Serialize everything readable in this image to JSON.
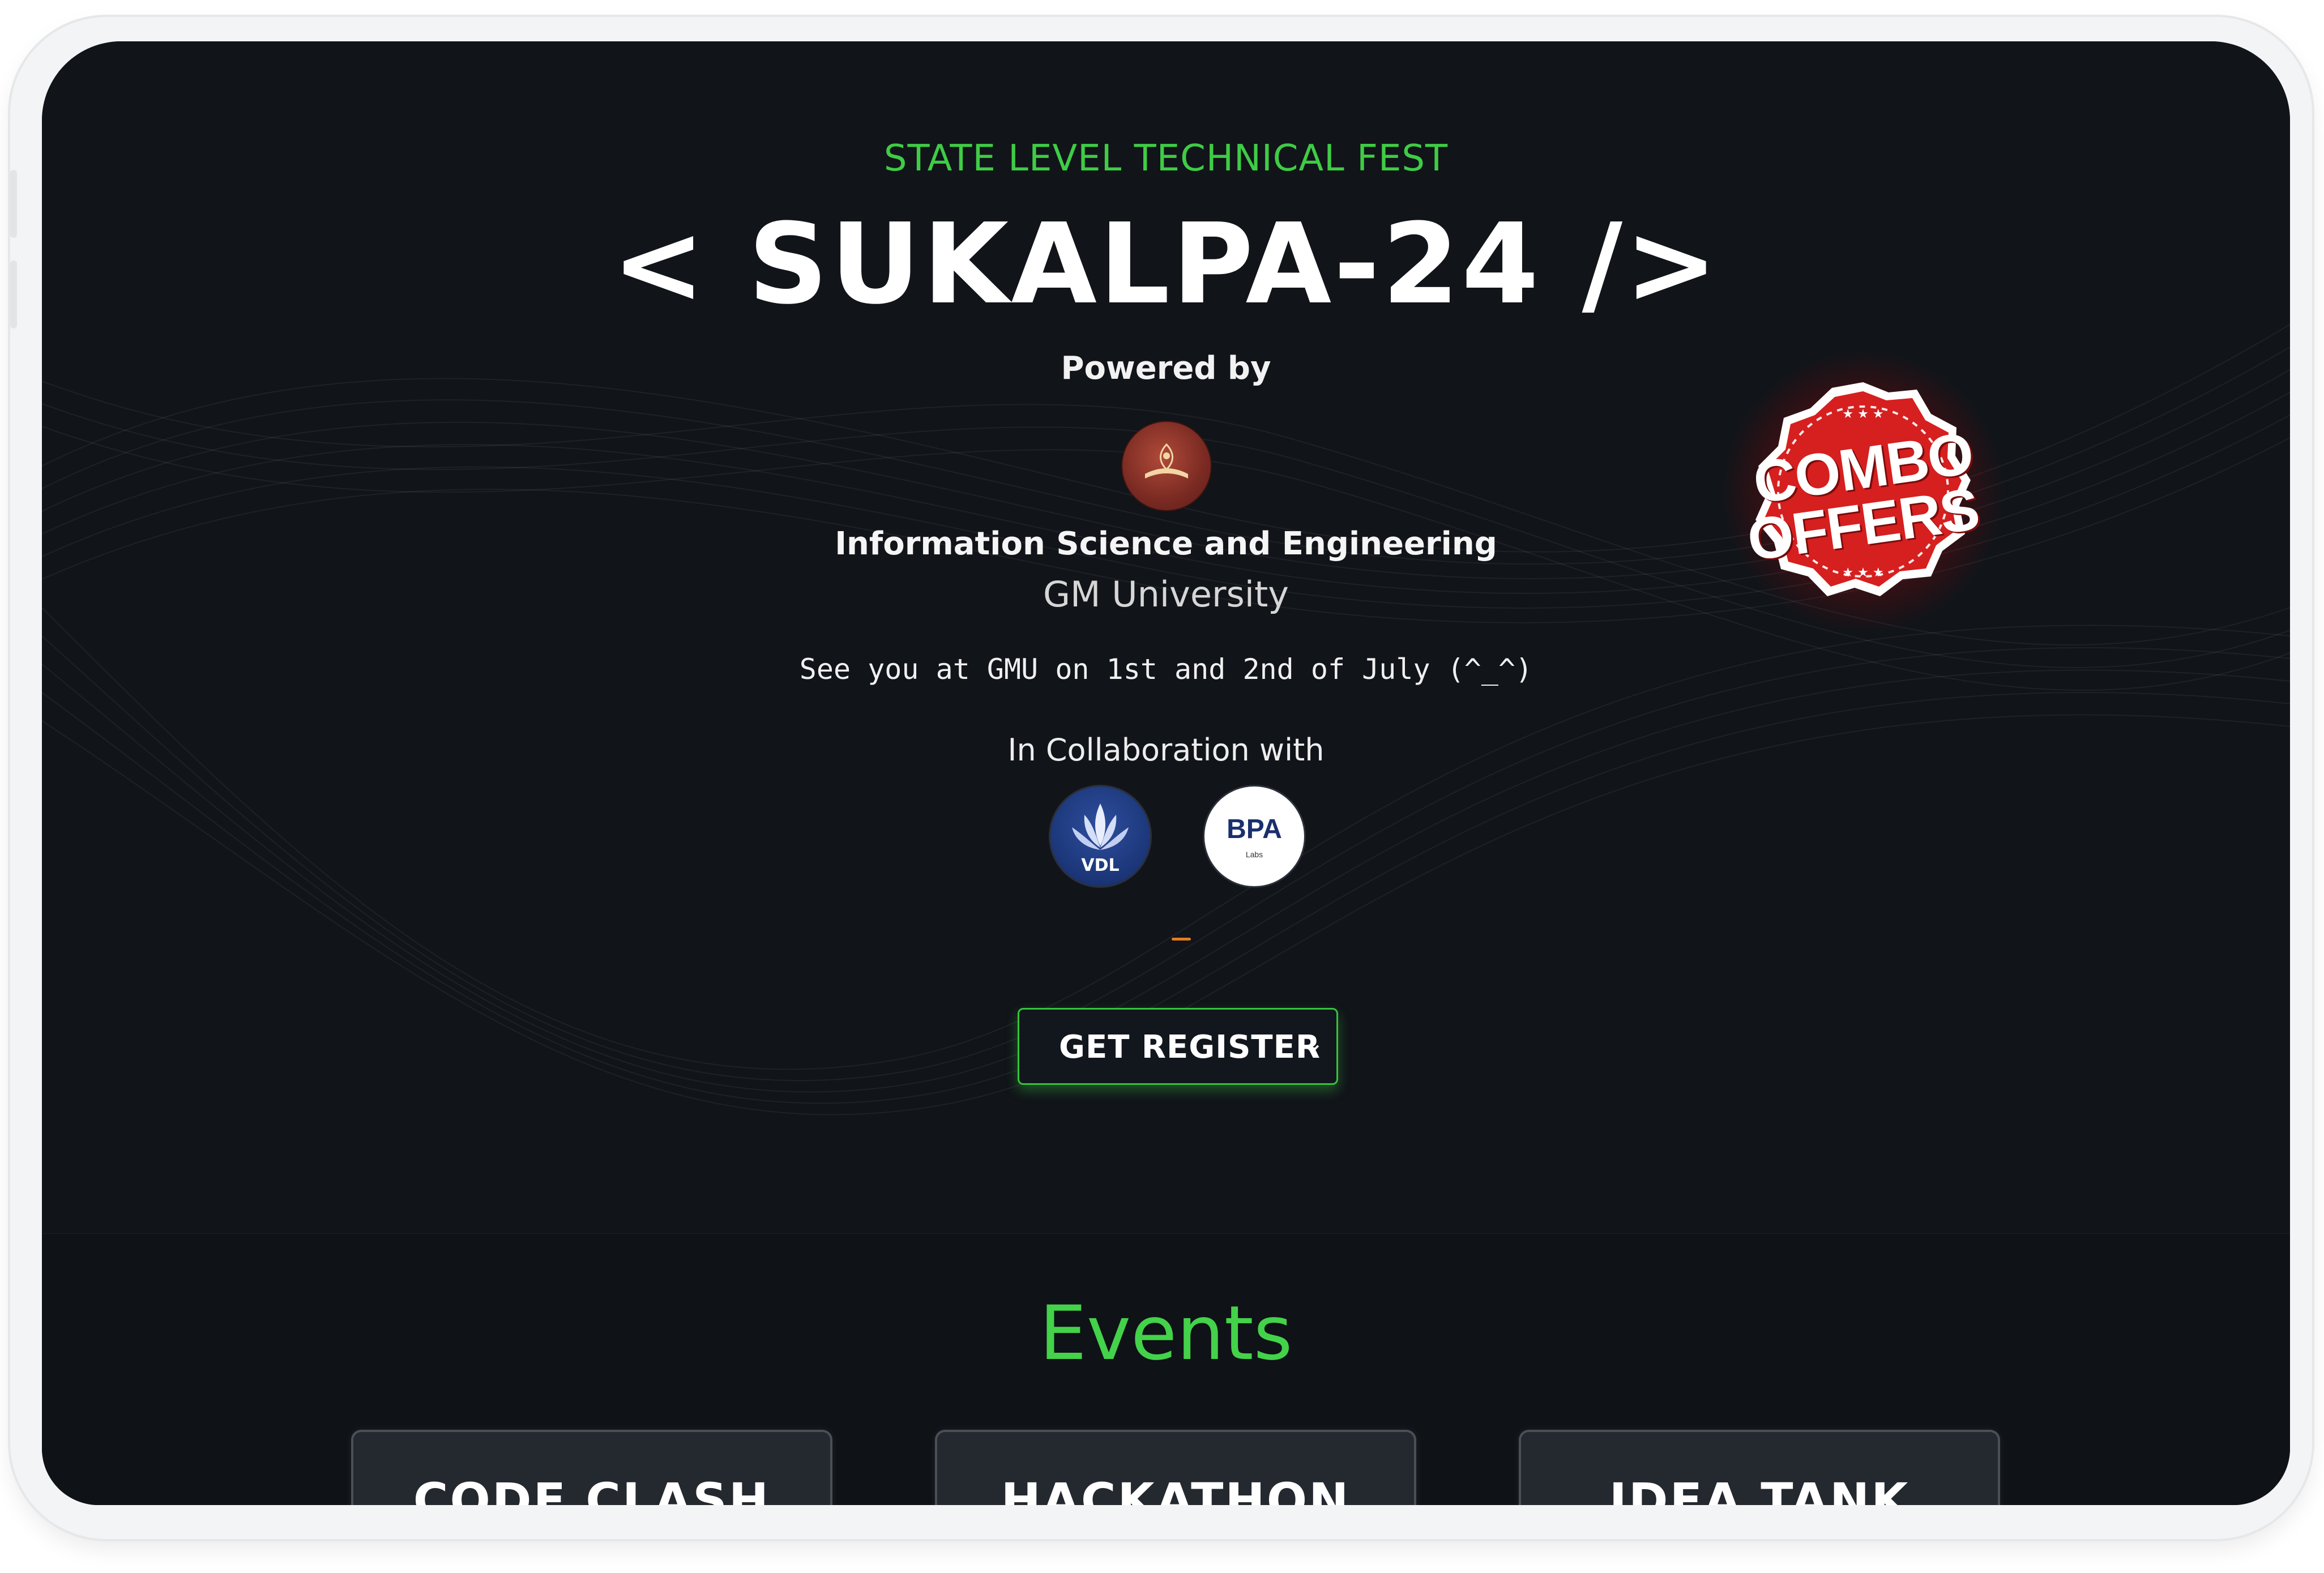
{
  "hero": {
    "subtitle": "STATE LEVEL TECHNICAL FEST",
    "title": "< SUKALPA-24 />",
    "powered_by": "Powered by",
    "department": "Information Science and Engineering",
    "university": "GM University",
    "tagline": "See you at GMU on 1st and 2nd of July (^_^)",
    "collab_label": "In Collaboration with",
    "collab_logos": [
      {
        "icon": "vdl-logo",
        "text": "VDL"
      },
      {
        "icon": "bpa-labs-logo",
        "text": "BPA",
        "subtext": "Labs"
      }
    ],
    "register_label": "GET REGISTER",
    "register_icon": "chevron-down-icon"
  },
  "badge": {
    "line1": "COMBO",
    "line2": "OFFERS",
    "color": "#d61f1f"
  },
  "events": {
    "title": "Events",
    "cards": [
      {
        "name": "CODE CLASH"
      },
      {
        "name": "HACKATHON"
      },
      {
        "name": "IDEA TANK"
      }
    ]
  },
  "colors": {
    "accent": "#3fcc45",
    "background": "#111419",
    "badge_red": "#d61f1f"
  }
}
